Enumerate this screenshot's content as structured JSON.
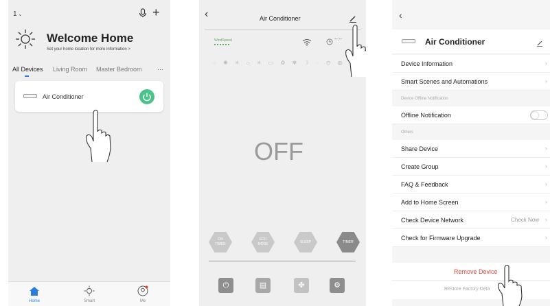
{
  "home": {
    "home_selector": "1",
    "welcome_title": "Welcome Home",
    "welcome_subtitle": "Set your home location for more information  >",
    "tabs": [
      "All Devices",
      "Living Room",
      "Master Bedroom"
    ],
    "more_label": "···",
    "device_name": "Air Conditioner",
    "nav": [
      {
        "label": "Home",
        "icon": "home-icon"
      },
      {
        "label": "Smart",
        "icon": "sun-icon"
      },
      {
        "label": "Me",
        "icon": "profile-icon"
      }
    ]
  },
  "control": {
    "title": "Air Conditioner",
    "back_glyph": "‹",
    "windspeed_label": "WindSpeed",
    "timer_readout": "--:--",
    "status": "OFF",
    "mode_buttons": [
      "ON\nTIMER",
      "ECO\nMODE",
      "SLEEP",
      "TIMER"
    ],
    "bottom_icons": [
      "power-icon",
      "display-icon",
      "fan-icon",
      "settings-icon"
    ]
  },
  "settings": {
    "back_glyph": "‹",
    "device_name": "Air Conditioner",
    "rows_top": [
      "Device Information",
      "Smart Scenes and Automations"
    ],
    "section_offline": "Device Offline Notification",
    "offline_row": "Offline Notification",
    "section_others": "Others",
    "rows_others": [
      "Share Device",
      "Create Group",
      "FAQ & Feedback",
      "Add to Home Screen",
      "Check Device Network",
      "Check for Firmware Upgrade"
    ],
    "check_now": "Check Now",
    "remove_device": "Remove Device",
    "restore_factory": "Restore Factory Defa",
    "chevron": "›"
  },
  "colors": {
    "accent_green": "#4cc38a",
    "home_blue": "#2a7de1",
    "remove_red": "#e0443a"
  }
}
